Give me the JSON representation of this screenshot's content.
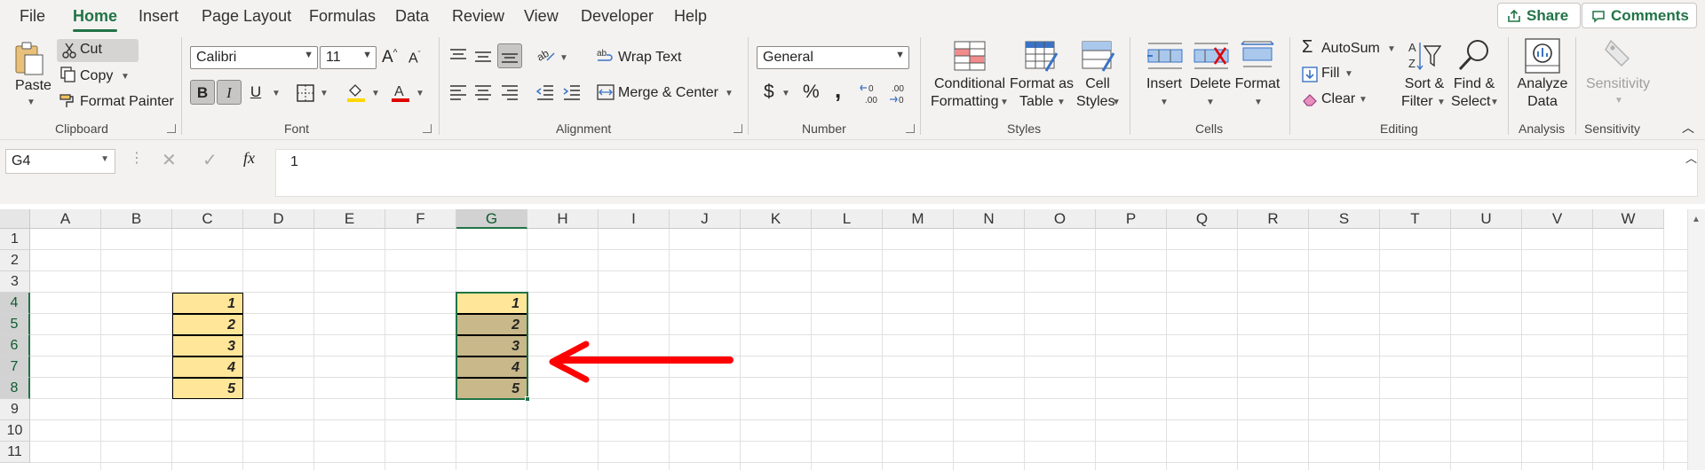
{
  "menu": {
    "tabs": [
      "File",
      "Home",
      "Insert",
      "Page Layout",
      "Formulas",
      "Data",
      "Review",
      "View",
      "Developer",
      "Help"
    ],
    "active": "Home",
    "share_label": "Share",
    "comments_label": "Comments"
  },
  "ribbon": {
    "clipboard": {
      "label": "Clipboard",
      "paste": "Paste",
      "cut": "Cut",
      "copy": "Copy",
      "format_painter": "Format Painter"
    },
    "font": {
      "label": "Font",
      "font_name": "Calibri",
      "font_size": "11",
      "bold": "B",
      "italic": "I",
      "underline": "U"
    },
    "alignment": {
      "label": "Alignment",
      "wrap_text": "Wrap Text",
      "merge_center": "Merge & Center"
    },
    "number": {
      "label": "Number",
      "format": "General",
      "currency": "$",
      "percent": "%",
      "comma": ",",
      "inc_dec": "←0 .00",
      "dec_dec": ".00 →0"
    },
    "styles": {
      "label": "Styles",
      "conditional_1": "Conditional",
      "conditional_2": "Formatting",
      "format_table_1": "Format as",
      "format_table_2": "Table",
      "cell_styles_1": "Cell",
      "cell_styles_2": "Styles"
    },
    "cells": {
      "label": "Cells",
      "insert": "Insert",
      "delete": "Delete",
      "format": "Format"
    },
    "editing": {
      "label": "Editing",
      "autosum": "AutoSum",
      "fill": "Fill",
      "clear": "Clear",
      "sort_1": "Sort &",
      "sort_2": "Filter",
      "find_1": "Find &",
      "find_2": "Select"
    },
    "analysis": {
      "label": "Analysis",
      "analyze_1": "Analyze",
      "analyze_2": "Data"
    },
    "sensitivity": {
      "label": "Sensitivity",
      "button": "Sensitivity"
    }
  },
  "formula_bar": {
    "name_box": "G4",
    "formula": "1",
    "fx": "fx"
  },
  "grid": {
    "columns": [
      "A",
      "B",
      "C",
      "D",
      "E",
      "F",
      "G",
      "H",
      "I",
      "J",
      "K",
      "L",
      "M",
      "N",
      "O",
      "P",
      "Q",
      "R",
      "S",
      "T",
      "U",
      "V",
      "W"
    ],
    "rows": [
      "1",
      "2",
      "3",
      "4",
      "5",
      "6",
      "7",
      "8",
      "9",
      "10",
      "11"
    ],
    "selected_column": "G",
    "selected_rows": [
      "4",
      "5",
      "6",
      "7",
      "8"
    ],
    "column_c_values": [
      "1",
      "2",
      "3",
      "4",
      "5"
    ],
    "column_g_values": [
      "1",
      "2",
      "3",
      "4",
      "5"
    ]
  },
  "colors": {
    "accent": "#217346",
    "cell_fill": "#ffe699",
    "selection_fill": "#c8b88a",
    "arrow": "#ff0000"
  }
}
